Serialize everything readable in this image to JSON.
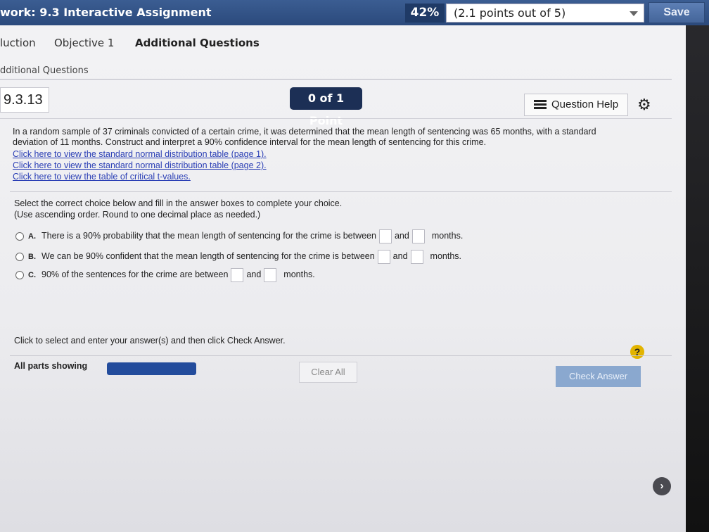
{
  "header": {
    "title": "work: 9.3 Interactive Assignment",
    "score_percent": "42%",
    "score_points": "(2.1 points out of 5)",
    "save_label": "Save"
  },
  "tabs": [
    {
      "label": "luction"
    },
    {
      "label": "Objective 1"
    },
    {
      "label": "Additional Questions"
    }
  ],
  "breadcrumb": "dditional Questions",
  "question": {
    "number": "9.3.13",
    "points_badge": "0 of 1 Point",
    "help_label": "Question Help",
    "text": "In a random sample of 37 criminals convicted of a certain crime, it was determined that the mean length of sentencing was 65 months, with a standard deviation of 11 months. Construct and interpret a 90% confidence interval for the mean length of sentencing for this crime.",
    "links": [
      "Click here to view the standard normal distribution table (page 1).",
      "Click here to view the standard normal distribution table (page 2).",
      "Click here to view the table of critical t-values."
    ]
  },
  "instructions": {
    "line1": "Select the correct choice below and fill in the answer boxes to complete your choice.",
    "line2": "(Use ascending order. Round to one decimal place as needed.)"
  },
  "choices": [
    {
      "letter": "A.",
      "text": "There is a 90% probability that the mean length of sentencing for the crime is between",
      "and": "and",
      "unit": "months."
    },
    {
      "letter": "B.",
      "text": "We can be 90% confident that the mean length of sentencing for the crime is between",
      "and": "and",
      "unit": "months."
    },
    {
      "letter": "C.",
      "text": "90% of the sentences for the crime are between",
      "and": "and",
      "unit": "months."
    }
  ],
  "footer": {
    "hint": "Click to select and enter your answer(s) and then click Check Answer.",
    "help_symbol": "?",
    "parts_label": "All parts showing",
    "progress_fraction": 1.0,
    "clear_label": "Clear All",
    "check_label": "Check Answer",
    "next_symbol": "›"
  }
}
